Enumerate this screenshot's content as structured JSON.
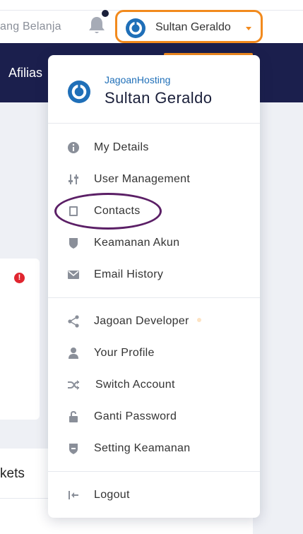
{
  "topbar": {
    "cart_text": "ang Belanja",
    "user_name": "Sultan Geraldo"
  },
  "navbar": {
    "afilias": "Afilias"
  },
  "background": {
    "tickets": "kets"
  },
  "dropdown": {
    "company": "JagoanHosting",
    "name": "Sultan Geraldo",
    "items": [
      {
        "label": "My Details",
        "icon": "info-icon"
      },
      {
        "label": "User Management",
        "icon": "sliders-icon"
      },
      {
        "label": "Contacts",
        "icon": "book-icon"
      },
      {
        "label": "Keamanan Akun",
        "icon": "shield-icon"
      },
      {
        "label": "Email History",
        "icon": "envelope-icon"
      },
      {
        "label": "Jagoan Developer",
        "icon": "share-icon"
      },
      {
        "label": "Your Profile",
        "icon": "user-icon"
      },
      {
        "label": "Switch Account",
        "icon": "shuffle-icon"
      },
      {
        "label": "Ganti Password",
        "icon": "unlock-icon"
      },
      {
        "label": "Setting Keamanan",
        "icon": "shield-minus-icon"
      },
      {
        "label": "Logout",
        "icon": "logout-icon"
      }
    ]
  },
  "colors": {
    "accent": "#f28a1d",
    "navbar": "#1b1f4d",
    "annotation": "#5b1f66",
    "brand_blue": "#1f6fb8"
  }
}
